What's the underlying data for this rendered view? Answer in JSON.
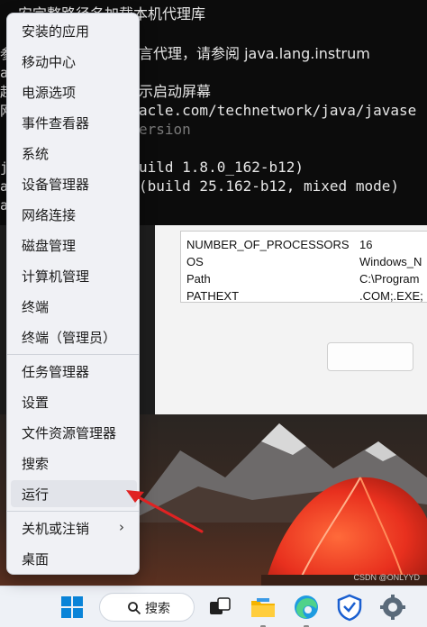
{
  "terminal": {
    "lines": [
      "安完整路径名加载本机代理库",
      "言代理，请参阅 java.lang.instrum",
      "示启动屏幕",
      "acle.com/technetwork/java/javase",
      "ersion",
      "uild 1.8.0_162-b12)",
      "(build 25.162-b12, mixed mode)"
    ],
    "left_fragments": [
      "参",
      "a",
      "起",
      "网",
      "j",
      "a",
      "a"
    ]
  },
  "env_vars": [
    {
      "name": "NUMBER_OF_PROCESSORS",
      "value": "16"
    },
    {
      "name": "OS",
      "value": "Windows_N"
    },
    {
      "name": "Path",
      "value": "C:\\Program"
    },
    {
      "name": "PATHEXT",
      "value": ".COM;.EXE;"
    }
  ],
  "context_menu": {
    "items": [
      {
        "label": "安装的应用"
      },
      {
        "label": "移动中心"
      },
      {
        "label": "电源选项"
      },
      {
        "label": "事件查看器"
      },
      {
        "label": "系统"
      },
      {
        "label": "设备管理器"
      },
      {
        "label": "网络连接"
      },
      {
        "label": "磁盘管理"
      },
      {
        "label": "计算机管理"
      },
      {
        "label": "终端"
      },
      {
        "label": "终端（管理员）"
      },
      {
        "label": "任务管理器"
      },
      {
        "label": "设置"
      },
      {
        "label": "文件资源管理器"
      },
      {
        "label": "搜索"
      },
      {
        "label": "运行"
      },
      {
        "label": "关机或注销"
      },
      {
        "label": "桌面"
      }
    ],
    "highlighted_item": "运行",
    "submenu_chevron": "›"
  },
  "taskbar": {
    "search_label": "搜索",
    "icons": [
      "windows-start-icon",
      "search-icon",
      "task-view-icon",
      "file-explorer-icon",
      "edge-browser-icon",
      "security-shield-icon",
      "settings-gear-icon"
    ]
  },
  "watermark": "CSDN @ONLYYD",
  "colors": {
    "accent_blue": "#0067c0",
    "arrow_red": "#e02222",
    "tent_red": "#e8301e",
    "terminal_bg": "#0c0c0c"
  }
}
